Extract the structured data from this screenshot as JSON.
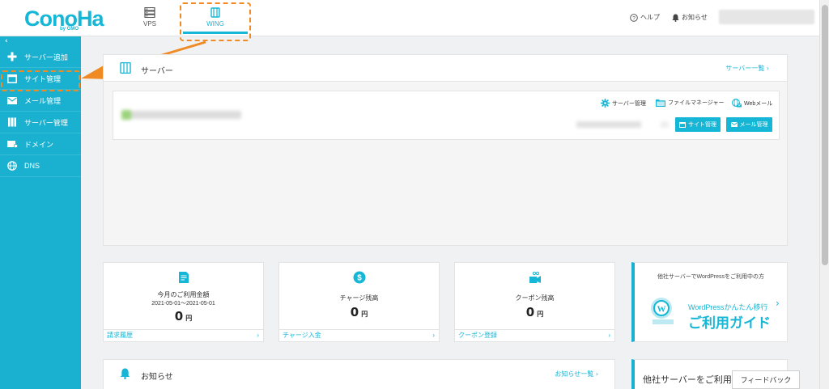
{
  "header": {
    "logo_text": "ConoHa",
    "logo_sub": "by GMO",
    "nav": [
      {
        "label": "VPS",
        "icon": "server-stack-icon"
      },
      {
        "label": "WING",
        "icon": "wing-server-icon"
      }
    ],
    "help_label": "ヘルプ",
    "notice_label": "お知らせ"
  },
  "sidebar": {
    "collapse_label": "‹",
    "items": [
      {
        "label": "サーバー追加",
        "icon": "plus-icon"
      },
      {
        "label": "サイト管理",
        "icon": "window-icon"
      },
      {
        "label": "メール管理",
        "icon": "mail-icon"
      },
      {
        "label": "サーバー管理",
        "icon": "server-icon"
      },
      {
        "label": "ドメイン",
        "icon": "domain-icon"
      },
      {
        "label": "DNS",
        "icon": "globe-icon"
      }
    ]
  },
  "server_card": {
    "title": "サーバー",
    "list_link": "サーバー一覧 ›",
    "tools": {
      "server_manage": "サーバー管理",
      "file_manager": "ファイルマネージャー",
      "webmail": "Webメール"
    },
    "buttons": {
      "site_manage": "サイト管理",
      "mail_manage": "メール管理"
    }
  },
  "billing": {
    "label": "今月のご利用金額",
    "date_range": "2021-05-01〜2021-05-01",
    "value": "0",
    "unit": "円",
    "footer": "請求履歴"
  },
  "charge": {
    "label": "チャージ残高",
    "value": "0",
    "unit": "円",
    "footer": "チャージ入金"
  },
  "coupon": {
    "label": "クーポン残高",
    "value": "0",
    "unit": "円",
    "footer": "クーポン登録"
  },
  "promo": {
    "top_text": "他社サーバーでWordPressをご利用中の方",
    "line1": "WordPressかんたん移行",
    "line2": "ご利用ガイド"
  },
  "news": {
    "title": "お知らせ",
    "link": "お知らせ一覧 ›"
  },
  "promo2": {
    "text": "他社サーバーをご利用"
  },
  "feedback_label": "フィードバック",
  "colors": {
    "accent": "#16b6d6",
    "sidebar": "#1ab0cf",
    "highlight": "#f08a24"
  }
}
